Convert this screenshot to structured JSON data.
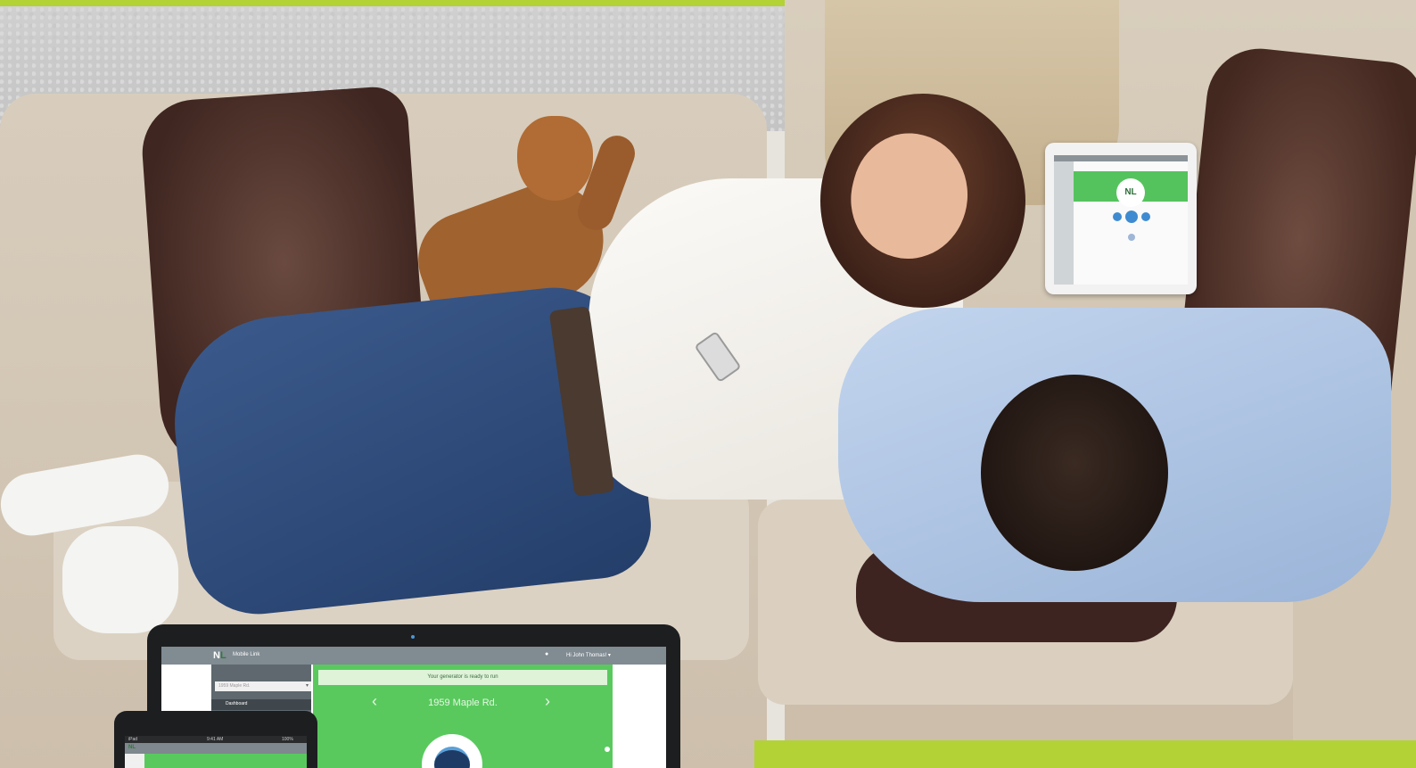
{
  "scene": {
    "description_colors": {
      "accent": "#b2d235",
      "app_green": "#59c95e",
      "app_header": "#808b92"
    }
  },
  "tablet": {
    "logo": "NL"
  },
  "laptop_app": {
    "logo_prefix": "N",
    "logo_suffix": "L",
    "brand": "Mobile Link",
    "header_icon": "bell-icon",
    "user": "Hi John Thomas! ▾",
    "site_select_placeholder": "1959 Maple Rd.",
    "nav_dashboard": "Dashboard",
    "status_banner": "Your generator is ready to run",
    "address": "1959 Maple Rd.",
    "prev": "‹",
    "next": "›"
  },
  "mini_tablet": {
    "status_left": "iPad",
    "status_time": "9:41 AM",
    "status_right": "100%",
    "logo": "NL"
  }
}
